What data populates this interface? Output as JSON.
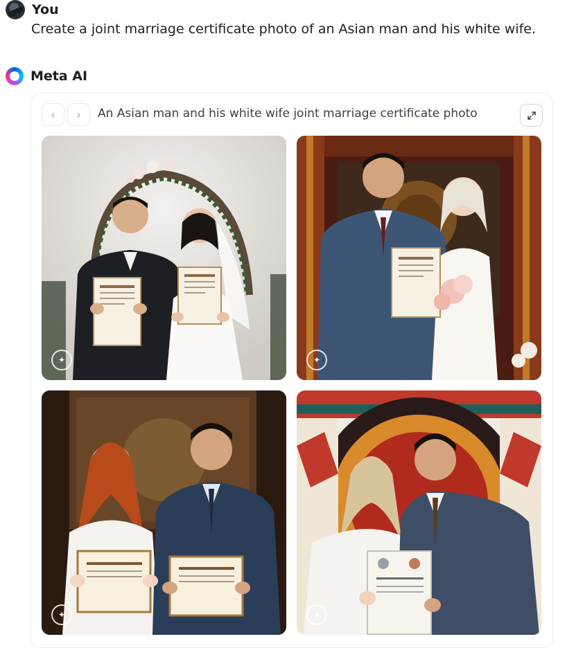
{
  "user_message": {
    "sender": "You",
    "text": "Create a joint marriage certificate photo of an Asian man and his white wife."
  },
  "assistant": {
    "sender": "Meta AI"
  },
  "card": {
    "title": "An Asian man and his white wife joint marriage certificate photo",
    "prev_icon": "chevron-left-icon",
    "next_icon": "chevron-right-icon",
    "expand_icon": "expand-icon"
  },
  "images": [
    {
      "name": "generated-image-1",
      "description": "couple in wedding attire holding certificates under floral arch"
    },
    {
      "name": "generated-image-2",
      "description": "couple holding certificate and bouquet in ornate red hall"
    },
    {
      "name": "generated-image-3",
      "description": "red-haired woman and man holding certificates before tapestry"
    },
    {
      "name": "generated-image-4",
      "description": "blonde woman and man holding certificate before red decorative backdrop"
    }
  ]
}
